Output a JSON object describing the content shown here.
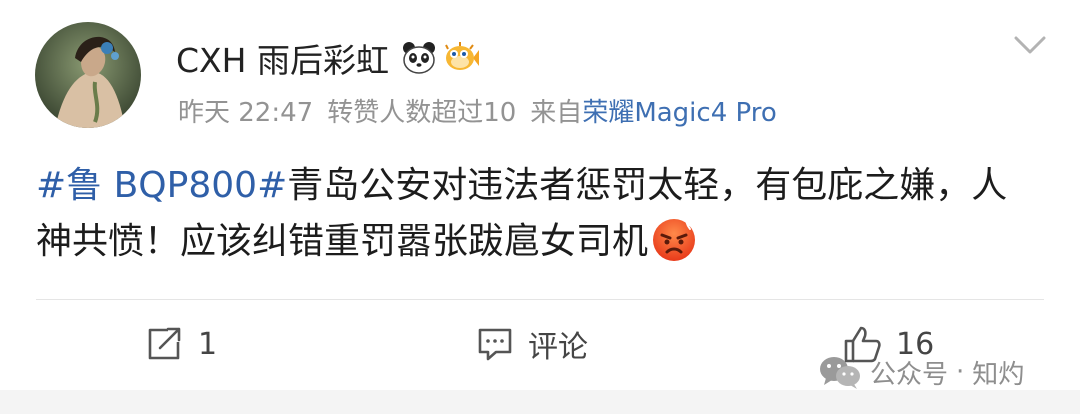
{
  "post": {
    "author": {
      "name": "CXH 雨后彩虹",
      "badges": [
        "panda-icon",
        "pufferfish-icon"
      ]
    },
    "meta": {
      "time": "昨天 22:47",
      "reposts_note": "转赞人数超过10",
      "source_prefix": "来自",
      "device": "荣耀Magic4 Pro"
    },
    "content": {
      "topic": "#鲁 BQP800#",
      "text": "青岛公安对违法者惩罚太轻，有包庇之嫌，人神共愤！应该纠错重罚嚣张跋扈女司机",
      "emoji": "angry-face-icon"
    },
    "actions": {
      "repost_count": "1",
      "comment_label": "评论",
      "like_count": "16"
    }
  },
  "watermark": {
    "text_a": "公众号",
    "dot": "·",
    "text_b": "知灼"
  },
  "colors": {
    "topic_blue": "#2f5fa8",
    "device_blue": "#3e6fb2",
    "meta_gray": "#939393",
    "text": "#1c1c1c"
  }
}
